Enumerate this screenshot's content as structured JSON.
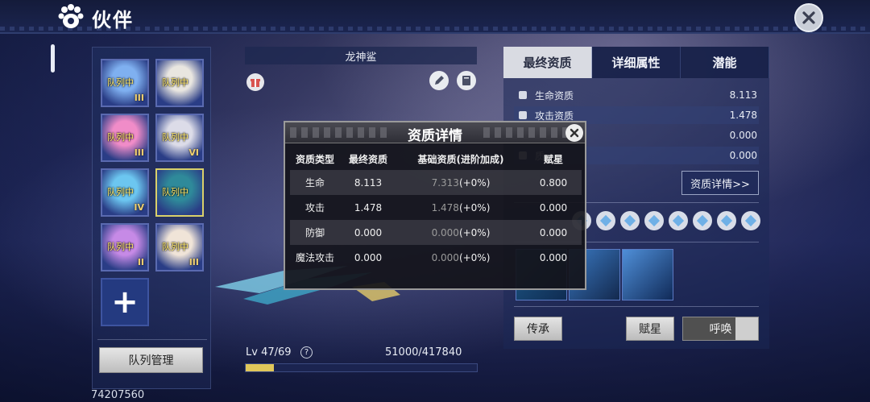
{
  "header": {
    "title": "伙伴"
  },
  "roster": {
    "slots": [
      {
        "status": "队列中",
        "rank": "III",
        "art": "#7fb0f0"
      },
      {
        "status": "队列中",
        "rank": "",
        "art": "#e9e6e0"
      },
      {
        "status": "队列中",
        "rank": "III",
        "art": "#f08cc8"
      },
      {
        "status": "队列中",
        "rank": "VI",
        "art": "#dcdce8"
      },
      {
        "status": "队列中",
        "rank": "IV",
        "art": "#6cc6f0"
      },
      {
        "status": "队列中",
        "rank": "",
        "art": "#2f8a9a"
      },
      {
        "status": "队列中",
        "rank": "II",
        "art": "#c68ae6"
      },
      {
        "status": "队列中",
        "rank": "III",
        "art": "#f0e4d8"
      }
    ],
    "add_label": "+",
    "team_button": "队列管理",
    "player_id": "74207560"
  },
  "companion": {
    "name": "龙神鲨",
    "level_label": "Lv 47/69",
    "help": "?",
    "exp_label": "51000/417840",
    "exp_current": 51000,
    "exp_max": 417840
  },
  "right_panel": {
    "tabs": [
      "最终资质",
      "详细属性",
      "潜能"
    ],
    "attributes": [
      {
        "label": "生命资质",
        "value": "8.113"
      },
      {
        "label": "攻击资质",
        "value": "1.478"
      },
      {
        "label": "",
        "value": "0.000"
      },
      {
        "label": "质",
        "value": "0.000"
      }
    ],
    "detail_button": "资质详情>>",
    "buttons": {
      "inherit": "传承",
      "star": "赋星",
      "summon": "呼唤"
    }
  },
  "modal": {
    "title": "资质详情",
    "columns": [
      "资质类型",
      "最终资质",
      "基础资质(进阶加成)",
      "赋星"
    ],
    "rows": [
      {
        "type": "生命",
        "final": "8.113",
        "base": "7.313",
        "bonus": "(+0%)",
        "star": "0.800"
      },
      {
        "type": "攻击",
        "final": "1.478",
        "base": "1.478",
        "bonus": "(+0%)",
        "star": "0.000"
      },
      {
        "type": "防御",
        "final": "0.000",
        "base": "0.000",
        "bonus": "(+0%)",
        "star": "0.000"
      },
      {
        "type": "魔法攻击",
        "final": "0.000",
        "base": "0.000",
        "bonus": "(+0%)",
        "star": "0.000"
      }
    ]
  },
  "colors": {
    "accent": "#d9d06a",
    "exp_fill": "#e0c75a"
  }
}
